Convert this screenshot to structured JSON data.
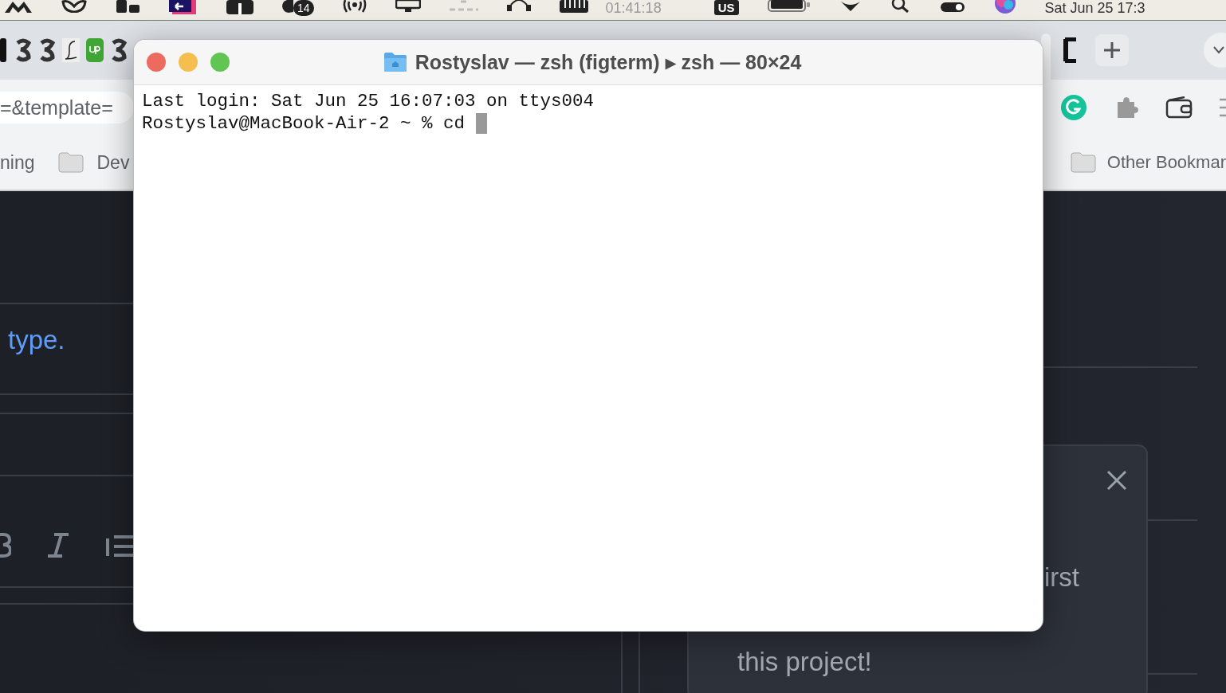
{
  "menu_bar": {
    "badge": "14",
    "clock": "01:41:18",
    "input_source": "US",
    "datetime": "Sat Jun 25  17:3"
  },
  "browser": {
    "address_fragment": "=&template=",
    "bookmarks": [
      {
        "label": "ning",
        "folder": false
      },
      {
        "label": "Dev",
        "folder": true
      }
    ],
    "other_bookmarks": "Other Bookmar"
  },
  "page": {
    "link_text": "type.",
    "popup": {
      "text_fragments": [
        "irst"
      ],
      "message_end": "this project!"
    }
  },
  "terminal": {
    "title": "Rostyslav — zsh (figterm) ▸ zsh — 80×24",
    "lines": [
      "Last login: Sat Jun 25 16:07:03 on ttys004",
      "Rostyslav@MacBook-Air-2 ~ % cd"
    ]
  }
}
